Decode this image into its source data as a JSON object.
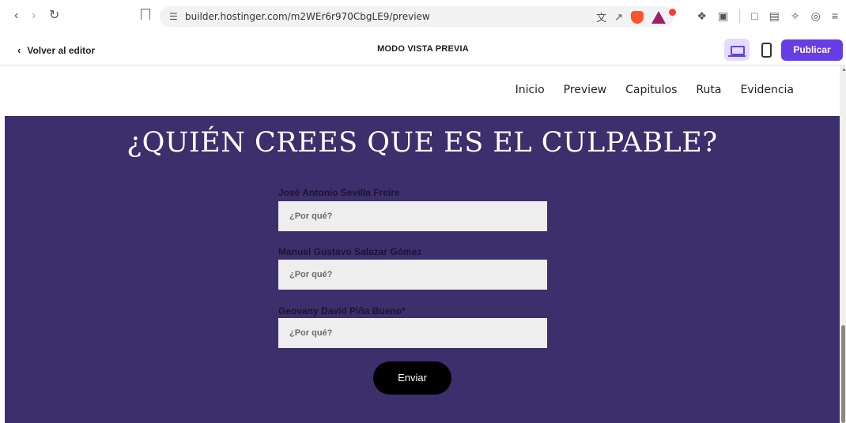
{
  "browser": {
    "url": "builder.hostinger.com/m2WEr6r970CbgLE9/preview",
    "icons": [
      "back-icon",
      "forward-icon",
      "reload-icon",
      "bookmark-icon",
      "site-settings-icon",
      "translate-icon",
      "share-icon",
      "brave-shields-icon",
      "brave-rewards-icon",
      "extensions-icon",
      "screenshot-icon",
      "sidebar-icon",
      "wallet-icon",
      "leo-icon",
      "vpn-icon",
      "menu-icon"
    ]
  },
  "builder": {
    "back_label": "Volver al editor",
    "mode_title": "MODO VISTA PREVIA",
    "publish_label": "Publicar",
    "accent_color": "#673de6"
  },
  "site_nav": {
    "links": [
      "Inicio",
      "Preview",
      "Capitulos",
      "Ruta",
      "Evidencia"
    ]
  },
  "form": {
    "heading": "¿QUIÉN CREES QUE ES EL CULPABLE?",
    "fields": [
      {
        "label": "José Antonio Sevilla Freire",
        "placeholder": "¿Por qué?"
      },
      {
        "label": "Manuel Gustavo Salazar Gómez",
        "placeholder": "¿Por qué?"
      },
      {
        "label": "Geovany David Piña Bueno*",
        "placeholder": "¿Por qué?"
      }
    ],
    "submit_label": "Enviar",
    "background_color": "#3c2f6c"
  }
}
